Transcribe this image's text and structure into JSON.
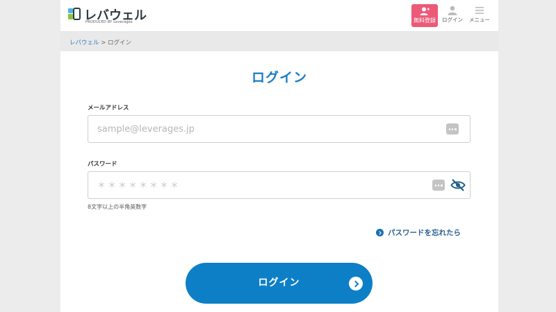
{
  "header": {
    "logo_text": "レバウェル",
    "logo_sub": "PRODUCED BY Leverages",
    "register_label": "無料登録",
    "login_label": "ログイン",
    "menu_label": "メニュー"
  },
  "breadcrumb": {
    "home": "レバウェル",
    "separator": " > ",
    "current": "ログイン"
  },
  "form": {
    "title": "ログイン",
    "email_label": "メールアドレス",
    "email_placeholder": "sample@leverages.jp",
    "password_label": "パスワード",
    "password_placeholder": "＊＊＊＊＊＊＊＊",
    "password_hint": "8文字以上の半角英数字",
    "forgot_label": "パスワードを忘れたら",
    "submit_label": "ログイン"
  },
  "colors": {
    "accent": "#1a7cc1",
    "button": "#0d7fc7",
    "register": "#ec5a78"
  }
}
